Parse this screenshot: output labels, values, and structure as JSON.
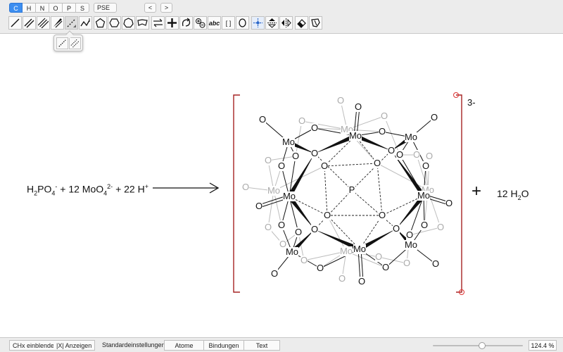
{
  "toolbar": {
    "elements": [
      "C",
      "H",
      "N",
      "O",
      "P",
      "S"
    ],
    "active_element": "C",
    "pse_label": "PSE",
    "nav_back": "<",
    "nav_forward": ">",
    "abc_label": "abc",
    "bracket_label": "[ ]"
  },
  "equation": {
    "reactant_h2po4": "H",
    "sub2": "2",
    "po": "PO",
    "sub4": "4",
    "sup_minus": "-",
    "plus1": " + 12 MoO",
    "sub4b": "4",
    "sup2minus": "2-",
    "plus2": " + 22 H",
    "sup_plus": "+",
    "charge": "3-",
    "plus_sign": "+",
    "water_coef": "12 H",
    "water_sub": "2",
    "water_o": "O"
  },
  "molecule": {
    "center_atom": "P",
    "metal_label": "Mo",
    "oxygen_label": "O"
  },
  "statusbar": {
    "chx_button": "CHx einblenden",
    "x_button": "|X| Anzeigen",
    "defaults_label": "Standardeinstellungen:",
    "atoms_tab": "Atome",
    "bonds_tab": "Bindungen",
    "text_tab": "Text",
    "zoom": "124.4 %",
    "zoom_fraction": 0.55
  }
}
